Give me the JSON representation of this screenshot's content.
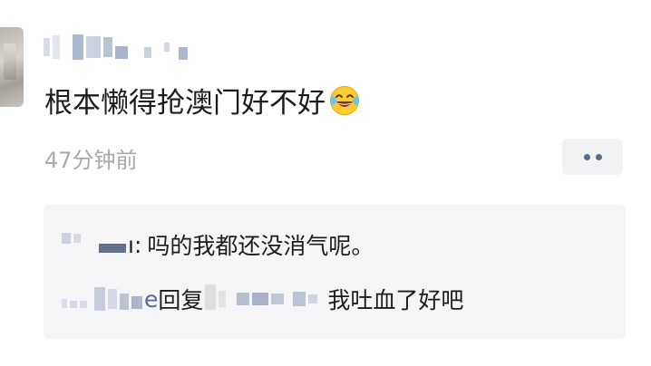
{
  "post": {
    "author_name": "",
    "text": "根本懒得抢澳门好不好",
    "emoji": "tears-of-joy-emoji",
    "timestamp": "47分钟前"
  },
  "more_button": {
    "icon": "more-dots-icon"
  },
  "comments": [
    {
      "author_suffix": "ı:",
      "text": "吗的我都还没消气呢。"
    },
    {
      "author_suffix": "e",
      "reply_word": "回复",
      "text": "我吐血了好吧"
    }
  ],
  "colors": {
    "name_blue": "#576b95",
    "timestamp_gray": "#a9a9a9",
    "comment_bg": "#f5f5f7"
  }
}
